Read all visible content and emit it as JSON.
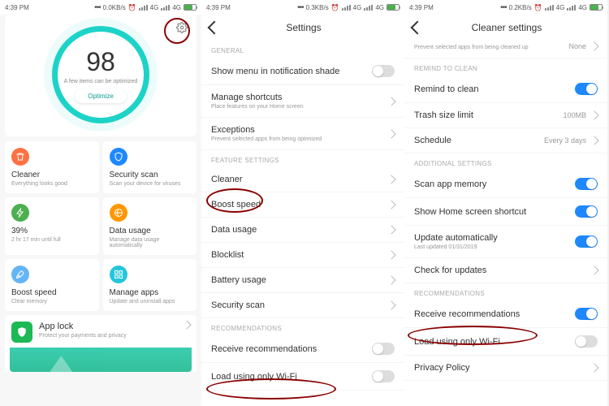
{
  "statusbar": {
    "time": "4:39 PM",
    "speed1": "0.0KB/s",
    "speed2": "0.3KB/s",
    "speed3": "0.2KB/s",
    "net": "4G"
  },
  "phone1": {
    "score": "98",
    "score_sub": "A few items can be optimized",
    "optimize": "Optimize",
    "cards": [
      {
        "title": "Cleaner",
        "sub": "Everything looks good",
        "color": "#ff7043",
        "icon": "trash"
      },
      {
        "title": "Security scan",
        "sub": "Scan your device for viruses",
        "color": "#1e88ff",
        "icon": "shield"
      },
      {
        "title": "39%",
        "sub": "2 hr 17 min  until full",
        "color": "#4caf50",
        "icon": "bolt"
      },
      {
        "title": "Data usage",
        "sub": "Manage data usage automatically",
        "color": "#ff9800",
        "icon": "data"
      },
      {
        "title": "Boost speed",
        "sub": "Clear memory",
        "color": "#64b5f6",
        "icon": "rocket"
      },
      {
        "title": "Manage apps",
        "sub": "Update and uninstall apps",
        "color": "#26c6da",
        "icon": "apps"
      }
    ],
    "applock": {
      "title": "App lock",
      "sub": "Protect your payments and privacy"
    }
  },
  "phone2": {
    "title": "Settings",
    "general_h": "GENERAL",
    "g1": "Show menu in notification shade",
    "g2": "Manage shortcuts",
    "g2s": "Place features on your Home screen",
    "g3": "Exceptions",
    "g3s": "Prevent selected apps from being optimized",
    "feature_h": "FEATURE SETTINGS",
    "f": [
      "Cleaner",
      "Boost speed",
      "Data usage",
      "Blocklist",
      "Battery usage",
      "Security scan"
    ],
    "rec_h": "RECOMMENDATIONS",
    "r1": "Receive recommendations",
    "r2": "Load using only Wi-Fi"
  },
  "phone3": {
    "title": "Cleaner settings",
    "top_sub": "Prevent selected apps from being cleaned up",
    "top_val": "None",
    "remind_h": "REMIND TO CLEAN",
    "r1": "Remind to clean",
    "r2": "Trash size limit",
    "r2v": "100MB",
    "r3": "Schedule",
    "r3v": "Every 3 days",
    "add_h": "ADDITIONAL SETTINGS",
    "a1": "Scan app memory",
    "a2": "Show Home screen shortcut",
    "a3": "Update automatically",
    "a3s": "Last updated 01/31/2019",
    "a4": "Check for updates",
    "rec_h": "RECOMMENDATIONS",
    "c1": "Receive recommendations",
    "c2": "Load using only Wi-Fi",
    "c3": "Privacy Policy"
  }
}
